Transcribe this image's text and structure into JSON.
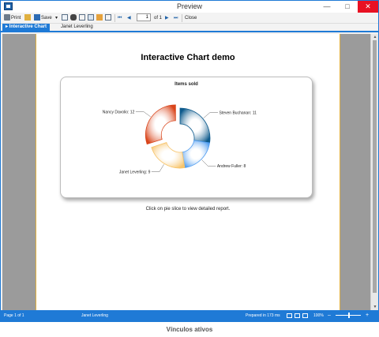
{
  "window": {
    "title": "Preview"
  },
  "toolbar": {
    "print_label": "Print",
    "save_label": "Save",
    "page_value": "1",
    "page_of": "of 1",
    "close_label": "Close"
  },
  "tabs": [
    {
      "label": "Interactive Chart"
    },
    {
      "label": "Janet Leverling"
    }
  ],
  "report": {
    "title": "Interactive Chart demo",
    "hint": "Click on pie slice to view detailed report."
  },
  "chart_data": {
    "type": "pie",
    "title": "Items sold",
    "donut": true,
    "categories": [
      "Steven Buchanan",
      "Andrew Fuller",
      "Janet Leverling",
      "Nancy Davolio"
    ],
    "values": [
      11,
      8,
      9,
      12
    ],
    "labels": [
      "Steven Buchanan: 11",
      "Andrew Fuller: 8",
      "Janet Leverling: 9",
      "Nancy Davolio: 12"
    ],
    "colors": [
      "#0d5a8c",
      "#4d9bf0",
      "#f7c46b",
      "#d9441a"
    ],
    "exploded": "Nancy Davolio"
  },
  "statusbar": {
    "page": "Page 1 of 1",
    "report_name": "Janet Leverling",
    "prepared": "Prepared in 173 ms",
    "zoom": "100%"
  },
  "caption": "Vínculos ativos"
}
